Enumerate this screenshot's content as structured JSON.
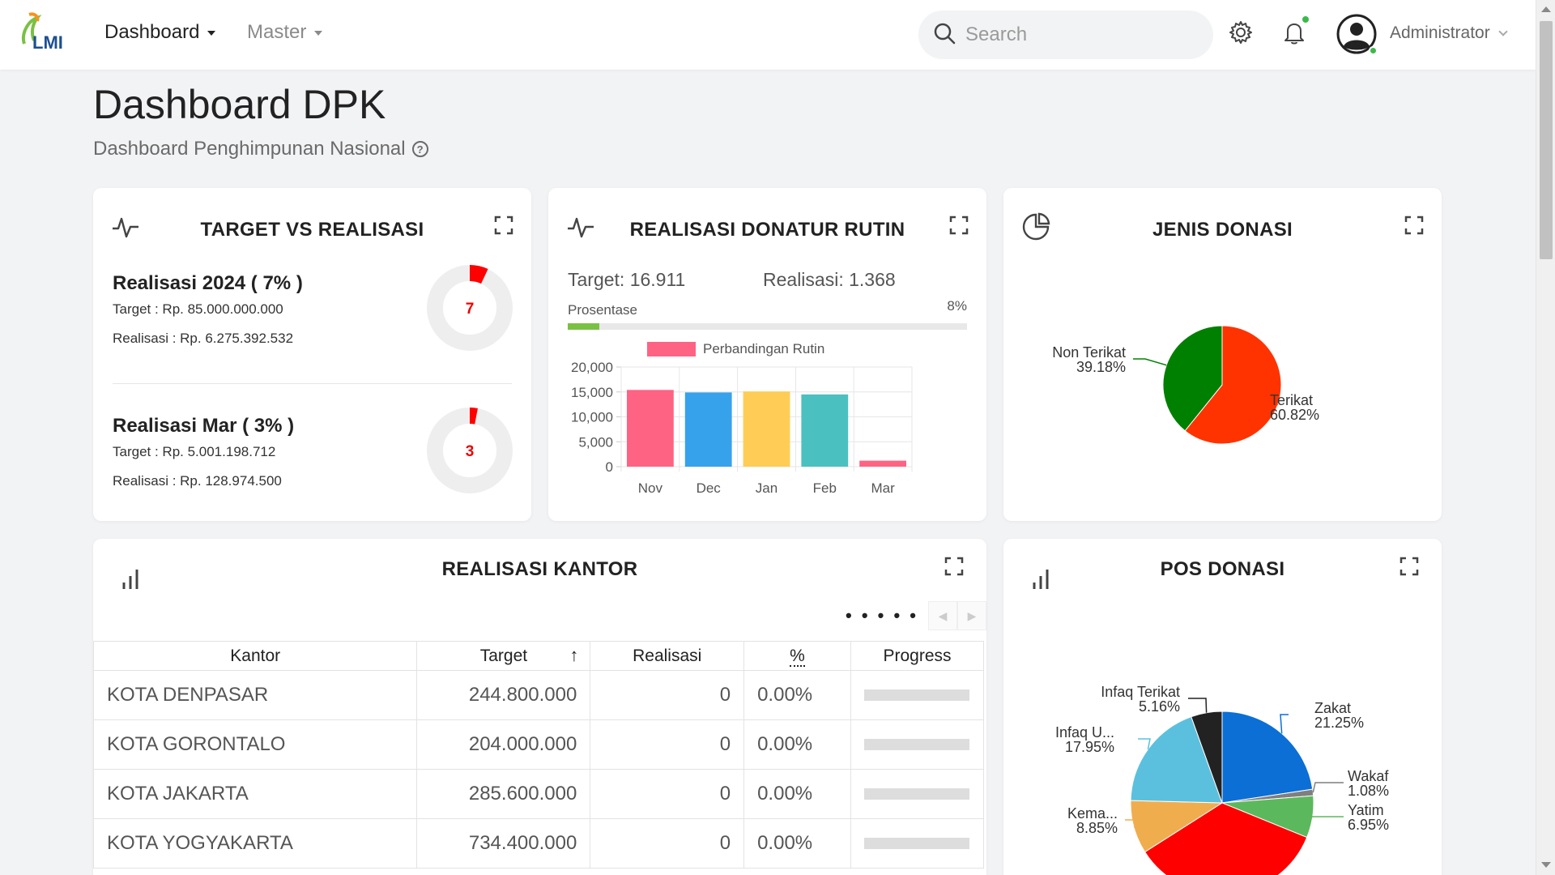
{
  "header": {
    "logo_text": "LMI",
    "nav": [
      {
        "label": "Dashboard",
        "active": true
      },
      {
        "label": "Master",
        "active": false
      }
    ],
    "search": {
      "placeholder": "Search",
      "value": ""
    },
    "icons": [
      "search-icon",
      "gear-icon",
      "bell-icon"
    ],
    "user": {
      "name": "Administrator"
    }
  },
  "page": {
    "title": "Dashboard DPK",
    "subtitle": "Dashboard Penghimpunan Nasional"
  },
  "target_card": {
    "title": "TARGET VS REALISASI",
    "blocks": [
      {
        "heading": "Realisasi 2024 ( 7% )",
        "target": "Target : Rp. 85.000.000.000",
        "realisasi": "Realisasi : Rp. 6.275.392.532",
        "gauge_label": "7",
        "gauge_percent": 7
      },
      {
        "heading": "Realisasi Mar ( 3% )",
        "target": "Target : Rp. 5.001.198.712",
        "realisasi": "Realisasi : Rp. 128.974.500",
        "gauge_label": "3",
        "gauge_percent": 3
      }
    ],
    "colors": {
      "gauge_fill": "#ff0000",
      "gauge_track": "#eeeeee"
    }
  },
  "rutin_card": {
    "title": "REALISASI DONATUR RUTIN",
    "target_text": "Target: 16.911",
    "realisasi_text": "Realisasi: 1.368",
    "progress_label": "Prosentase",
    "progress_value_text": "8%",
    "progress_percent": 8
  },
  "jenis_card": {
    "title": "JENIS DONASI"
  },
  "kantor_card": {
    "title": "REALISASI KANTOR",
    "pager_dots": "• • • • •",
    "columns": [
      "Kantor",
      "Target",
      "Realisasi",
      "%",
      "Progress"
    ],
    "sort_indicator": "↑",
    "rows": [
      {
        "kantor": "KOTA DENPASAR",
        "target": "244.800.000",
        "realisasi": "0",
        "pct": "0.00%",
        "progress": 0
      },
      {
        "kantor": "KOTA GORONTALO",
        "target": "204.000.000",
        "realisasi": "0",
        "pct": "0.00%",
        "progress": 0
      },
      {
        "kantor": "KOTA JAKARTA",
        "target": "285.600.000",
        "realisasi": "0",
        "pct": "0.00%",
        "progress": 0
      },
      {
        "kantor": "KOTA YOGYAKARTA",
        "target": "734.400.000",
        "realisasi": "0",
        "pct": "0.00%",
        "progress": 0
      }
    ]
  },
  "pos_card": {
    "title": "POS DONASI"
  },
  "chart_data": [
    {
      "type": "bar",
      "legend": [
        "Perbandingan Rutin"
      ],
      "categories": [
        "Nov",
        "Dec",
        "Jan",
        "Feb",
        "Mar"
      ],
      "values": [
        15400,
        14900,
        15100,
        14500,
        1200
      ],
      "colors": [
        "#ff6384",
        "#36a2eb",
        "#ffcd56",
        "#4bc0c0",
        "#ff6384"
      ],
      "ylim": [
        0,
        20000
      ],
      "yticks": [
        "20,000",
        "15,000",
        "10,000",
        "5,000",
        "0"
      ],
      "legend_color": "#ff6384"
    },
    {
      "type": "pie",
      "slices": [
        {
          "label": "Terikat",
          "value": 60.82,
          "value_text": "60.82%",
          "color": "#ff3300"
        },
        {
          "label": "Non Terikat",
          "value": 39.18,
          "value_text": "39.18%",
          "color": "#008000"
        }
      ]
    },
    {
      "type": "pie",
      "slices": [
        {
          "label": "Zakat",
          "value": 21.25,
          "value_text": "21.25%",
          "color": "#0b6fd6"
        },
        {
          "label": "Wakaf",
          "value": 1.08,
          "value_text": "1.08%",
          "color": "#7f7f7f"
        },
        {
          "label": "Yatim",
          "value": 6.95,
          "value_text": "6.95%",
          "color": "#5cb85c"
        },
        {
          "label": "",
          "value": 32.76,
          "value_text": "",
          "color": "#ff0000"
        },
        {
          "label": "Kema...",
          "value": 8.85,
          "value_text": "8.85%",
          "color": "#f0ad4e"
        },
        {
          "label": "Infaq U...",
          "value": 17.95,
          "value_text": "17.95%",
          "color": "#5bc0de"
        },
        {
          "label": "Infaq Terikat",
          "value": 5.16,
          "value_text": "5.16%",
          "color": "#222222"
        }
      ]
    }
  ]
}
